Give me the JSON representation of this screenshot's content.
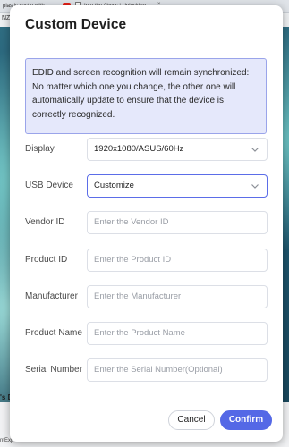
{
  "background": {
    "tabs": [
      {
        "label": "plastic castle with"
      },
      {
        "label": "Into the Abyss | Unlocking"
      }
    ],
    "tab_close_glyph": "×",
    "top_text": "NZYF",
    "bottom_heading": "'s D",
    "bottom_caption": "ntExp"
  },
  "dialog": {
    "title": "Custom Device",
    "notice": "EDID and screen recognition will remain synchronized: No matter which one you change, the other one will automatically update to ensure that the device is correctly recognized.",
    "fields": {
      "display": {
        "label": "Display",
        "value": "1920x1080/ASUS/60Hz"
      },
      "usb_device": {
        "label": "USB Device",
        "value": "Customize"
      },
      "vendor_id": {
        "label": "Vendor ID",
        "placeholder": "Enter the Vendor ID"
      },
      "product_id": {
        "label": "Product ID",
        "placeholder": "Enter the Product ID"
      },
      "manufacturer": {
        "label": "Manufacturer",
        "placeholder": "Enter the Manufacturer"
      },
      "product_name": {
        "label": "Product Name",
        "placeholder": "Enter the Product Name"
      },
      "serial_number": {
        "label": "Serial Number",
        "placeholder": "Enter the Serial Number(Optional)"
      }
    },
    "buttons": {
      "cancel": "Cancel",
      "confirm": "Confirm"
    }
  },
  "colors": {
    "accent": "#5468e6",
    "notice_bg": "#e5e8fb",
    "notice_border": "#9aa4ea"
  },
  "icons": {
    "select_chevron": "chevron-down-icon"
  }
}
